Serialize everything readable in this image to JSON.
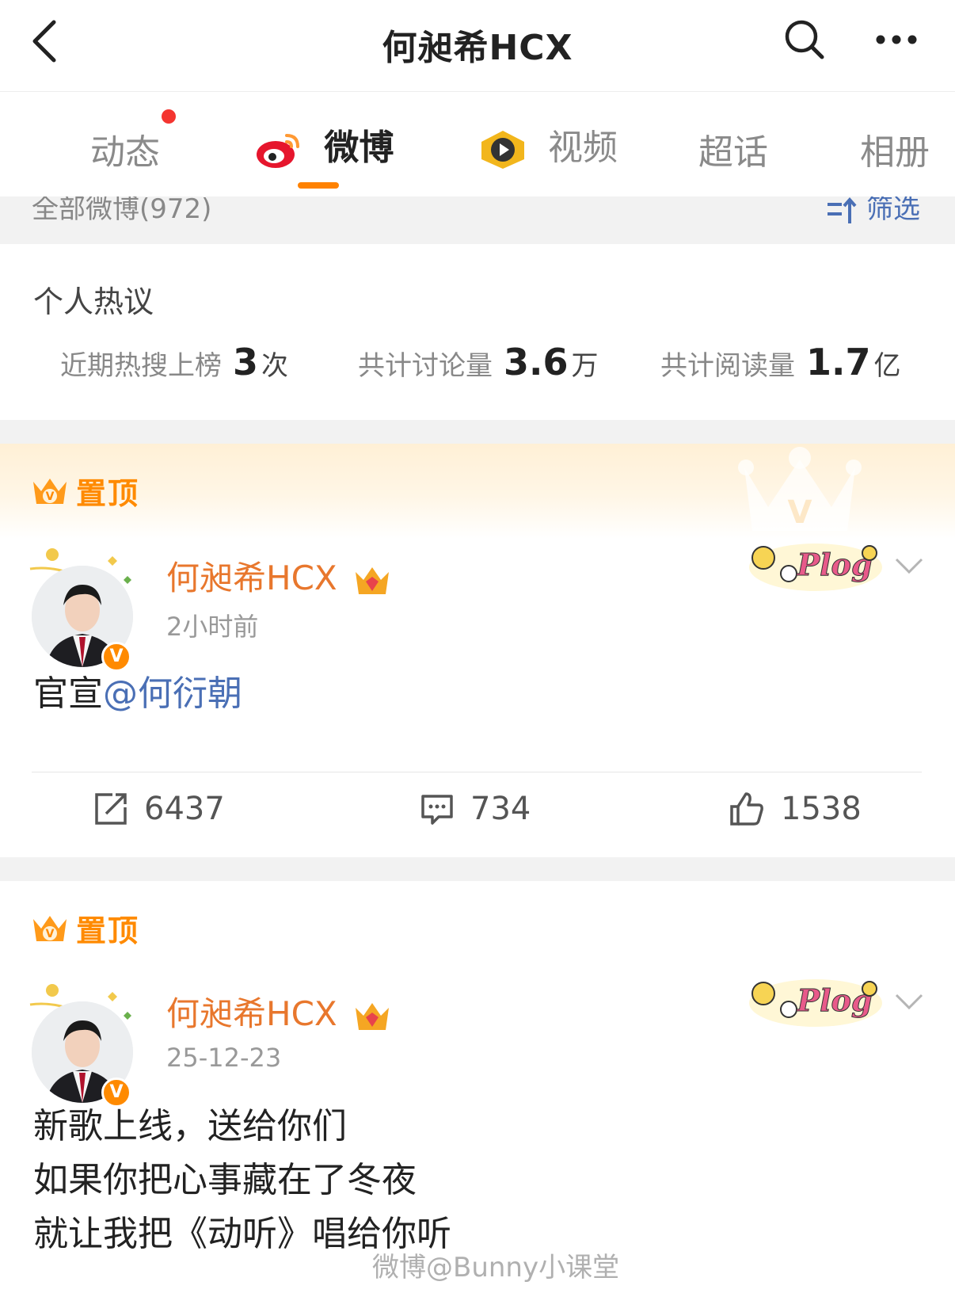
{
  "header": {
    "title": "何昶希HCX"
  },
  "tabs": [
    {
      "label": "动态",
      "active": false,
      "dot": true
    },
    {
      "label": "微博",
      "active": true,
      "icon": "weibo-logo-icon"
    },
    {
      "label": "视频",
      "active": false,
      "icon": "video-play-icon"
    },
    {
      "label": "超话",
      "active": false
    },
    {
      "label": "相册",
      "active": false
    }
  ],
  "filter_strip": {
    "count_label": "全部微博(972)",
    "filter_label": "筛选"
  },
  "hot": {
    "title": "个人热议",
    "stats": [
      {
        "label": "近期热搜上榜",
        "value": "3",
        "unit": "次"
      },
      {
        "label": "共计讨论量",
        "value": "3.6",
        "unit": "万"
      },
      {
        "label": "共计阅读量",
        "value": "1.7",
        "unit": "亿"
      }
    ]
  },
  "posts": [
    {
      "pin_label": "置顶",
      "author": "何昶希HCX",
      "time": "2小时前",
      "text_prefix": "官宣",
      "mention": "@何衍朝",
      "repost": "6437",
      "comments": "734",
      "likes": "1538"
    },
    {
      "pin_label": "置顶",
      "author": "何昶希HCX",
      "time": "25-12-23",
      "lines": [
        "新歌上线，送给你们",
        "如果你把心事藏在了冬夜",
        "就让我把《动听》唱给你听"
      ]
    }
  ],
  "sticker_text": "Plog",
  "watermark": "微博@Bunny小课堂",
  "colors": {
    "accent_orange": "#ff8200",
    "username_orange": "#e8772d",
    "mention_blue": "#4a6fb5",
    "red_dot": "#f43530"
  }
}
